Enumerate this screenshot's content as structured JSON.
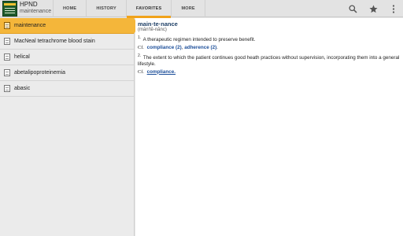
{
  "app": {
    "title": "HPND",
    "subtitle": "maintenance",
    "icon": "book-app-icon"
  },
  "tabs": [
    {
      "label": "HOME",
      "active": false
    },
    {
      "label": "HISTORY",
      "active": false
    },
    {
      "label": "FAVORITES",
      "active": true
    },
    {
      "label": "MORE",
      "active": false
    }
  ],
  "actions": [
    "search-icon",
    "star-icon",
    "overflow-menu-icon"
  ],
  "list": [
    {
      "label": "maintenance",
      "selected": true
    },
    {
      "label": "MacNeal tetrachrome blood stain",
      "selected": false
    },
    {
      "label": "helical",
      "selected": false
    },
    {
      "label": "abetalipoproteinemia",
      "selected": false
    },
    {
      "label": "abasic",
      "selected": false
    }
  ],
  "entry": {
    "headword": "main·te·nance",
    "pronunciation": "(mānʹtĕ-nănc)",
    "sense1": {
      "num": "1.",
      "text": "A therapeutic regimen intended to preserve benefit.",
      "cf_label": "Cf.",
      "xrefs": [
        "compliance (2)",
        "adherence (2)"
      ],
      "sep": ", ",
      "end": "."
    },
    "sense2": {
      "num": "2.",
      "text": "The extent to which the patient continues good heath practices without supervision, incorporating them into a general lifestyle.",
      "cf_label": "Cf.",
      "xref": "compliance."
    }
  },
  "colors": {
    "accent": "#f0a21a",
    "selected_row": "#f4b63a",
    "link": "#1d4f9a"
  }
}
